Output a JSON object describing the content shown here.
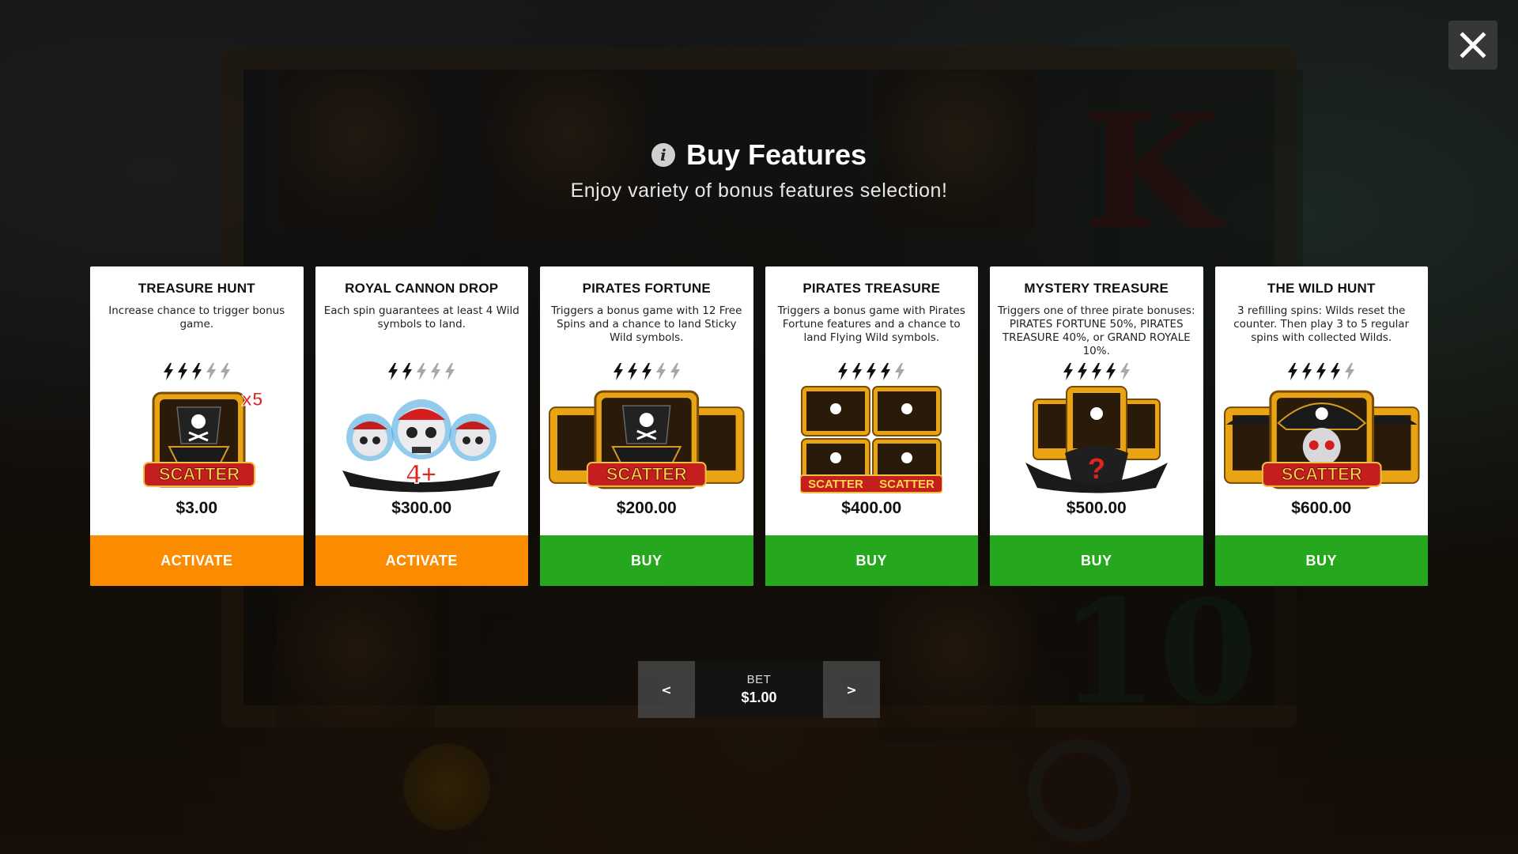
{
  "header": {
    "title": "Buy Features",
    "subtitle": "Enjoy variety of bonus features selection!",
    "info_icon": "info-icon"
  },
  "close_icon": "close-icon",
  "colors": {
    "activate": "#fb8c00",
    "buy": "#25a81d",
    "bolt_active": "#111111",
    "bolt_inactive": "#a8a8a8"
  },
  "cards": [
    {
      "title": "TREASURE HUNT",
      "description": "Increase chance to trigger bonus game.",
      "volatility": 3,
      "volatility_max": 5,
      "image": "scatter-ship-x5",
      "image_text": "SCATTER",
      "image_badge": "x5",
      "price": "$3.00",
      "button": "ACTIVATE"
    },
    {
      "title": "ROYAL CANNON DROP",
      "description": "Each spin guarantees at least 4 Wild symbols to land.",
      "volatility": 2,
      "volatility_max": 5,
      "image": "pirate-skulls-4plus",
      "image_text": "4+",
      "price": "$300.00",
      "button": "ACTIVATE"
    },
    {
      "title": "PIRATES FORTUNE",
      "description": "Triggers a bonus game with 12 Free Spins and a chance to land Sticky Wild symbols.",
      "volatility": 3,
      "volatility_max": 5,
      "image": "scatter-ships-three",
      "image_text": "SCATTER",
      "price": "$200.00",
      "button": "BUY"
    },
    {
      "title": "PIRATES TREASURE",
      "description": "Triggers a bonus game with Pirates Fortune features and a chance to land Flying Wild symbols.",
      "volatility": 4,
      "volatility_max": 5,
      "image": "scatter-ships-grid",
      "image_text": "SCATTER",
      "price": "$400.00",
      "button": "BUY"
    },
    {
      "title": "MYSTERY TREASURE",
      "description": "Triggers one of three pirate bonuses: PIRATES FORTUNE 50%, PIRATES TREASURE 40%, or GRAND ROYALE 10%.",
      "volatility": 4,
      "volatility_max": 5,
      "image": "mystery-ships",
      "image_text": "?",
      "price": "$500.00",
      "button": "BUY"
    },
    {
      "title": "THE WILD HUNT",
      "description": "3 refilling spins: Wilds reset the counter. Then play 3 to 5 regular spins with collected Wilds.",
      "volatility": 4,
      "volatility_max": 5,
      "image": "scatter-pirate-skull",
      "image_text": "SCATTER",
      "price": "$600.00",
      "button": "BUY"
    }
  ],
  "bet": {
    "label": "BET",
    "value": "$1.00",
    "prev": "<",
    "next": ">"
  }
}
